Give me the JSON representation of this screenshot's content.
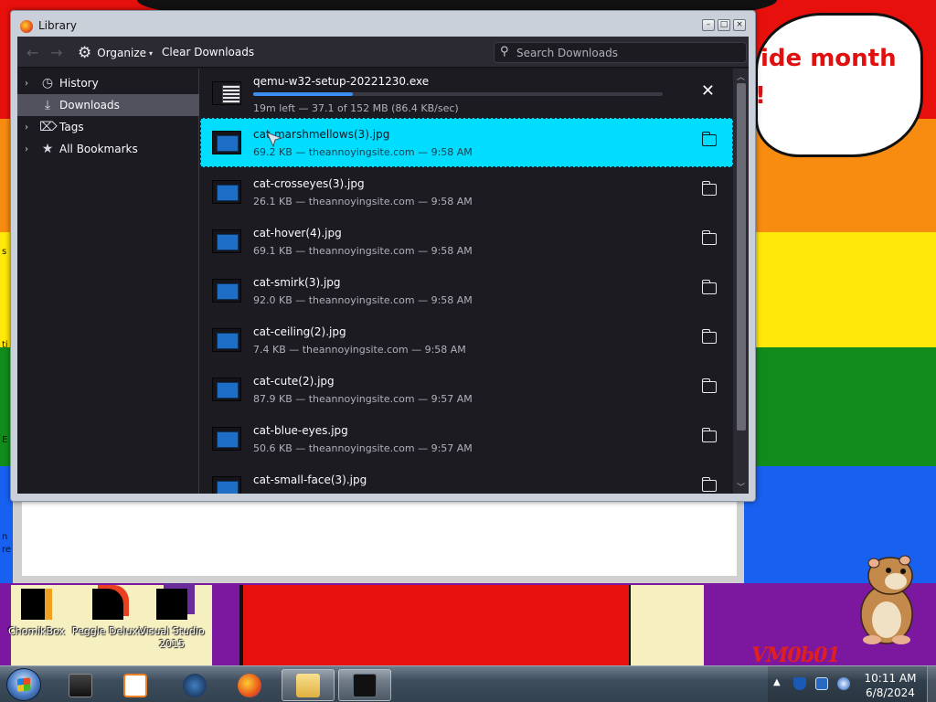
{
  "window": {
    "title": "Library"
  },
  "toolbar": {
    "organize_label": "Organize",
    "clear_label": "Clear Downloads",
    "search_placeholder": "Search Downloads"
  },
  "sidebar": {
    "items": [
      {
        "label": "History",
        "icon": "clock-icon",
        "selected": false,
        "expandable": true
      },
      {
        "label": "Downloads",
        "icon": "download-icon",
        "selected": true,
        "expandable": false
      },
      {
        "label": "Tags",
        "icon": "tag-icon",
        "selected": false,
        "expandable": true
      },
      {
        "label": "All Bookmarks",
        "icon": "star-icon",
        "selected": false,
        "expandable": true
      }
    ]
  },
  "downloads": {
    "active": {
      "name": "qemu-w32-setup-20221230.exe",
      "status": "19m left — 37.1 of 152 MB (86.4 KB/sec)",
      "progress": 0.244
    },
    "items": [
      {
        "name": "cat-marshmellows(3).jpg",
        "meta": "69.2 KB — theannoyingsite.com — 9:58 AM",
        "selected": true
      },
      {
        "name": "cat-crosseyes(3).jpg",
        "meta": "26.1 KB — theannoyingsite.com — 9:58 AM",
        "selected": false
      },
      {
        "name": "cat-hover(4).jpg",
        "meta": "69.1 KB — theannoyingsite.com — 9:58 AM",
        "selected": false
      },
      {
        "name": "cat-smirk(3).jpg",
        "meta": "92.0 KB — theannoyingsite.com — 9:58 AM",
        "selected": false
      },
      {
        "name": "cat-ceiling(2).jpg",
        "meta": "7.4 KB — theannoyingsite.com — 9:58 AM",
        "selected": false
      },
      {
        "name": "cat-cute(2).jpg",
        "meta": "87.9 KB — theannoyingsite.com — 9:57 AM",
        "selected": false
      },
      {
        "name": "cat-blue-eyes.jpg",
        "meta": "50.6 KB — theannoyingsite.com — 9:57 AM",
        "selected": false
      },
      {
        "name": "cat-small-face(3).jpg",
        "meta": "",
        "selected": false
      }
    ]
  },
  "desktop": {
    "speech_line1": "ide month",
    "speech_line2": "!",
    "watermark": "VM0b01",
    "edge_texts": [
      "s",
      "ti",
      "E",
      "n",
      "re"
    ],
    "icons": [
      {
        "label": "ChomikBox"
      },
      {
        "label": "Peggle Deluxe"
      },
      {
        "label": "Visual Studio 2015"
      }
    ]
  },
  "taskbar": {
    "time": "10:11 AM",
    "date": "6/8/2024",
    "tray_arrow": "▲",
    "tasks": [
      "cmd",
      "media-player",
      "app",
      "firefox",
      "explorer",
      "terminal"
    ]
  },
  "colors": {
    "selected_row": "#00ddff",
    "progress": "#3b8ff0",
    "dark_bg": "#1c1b22"
  }
}
